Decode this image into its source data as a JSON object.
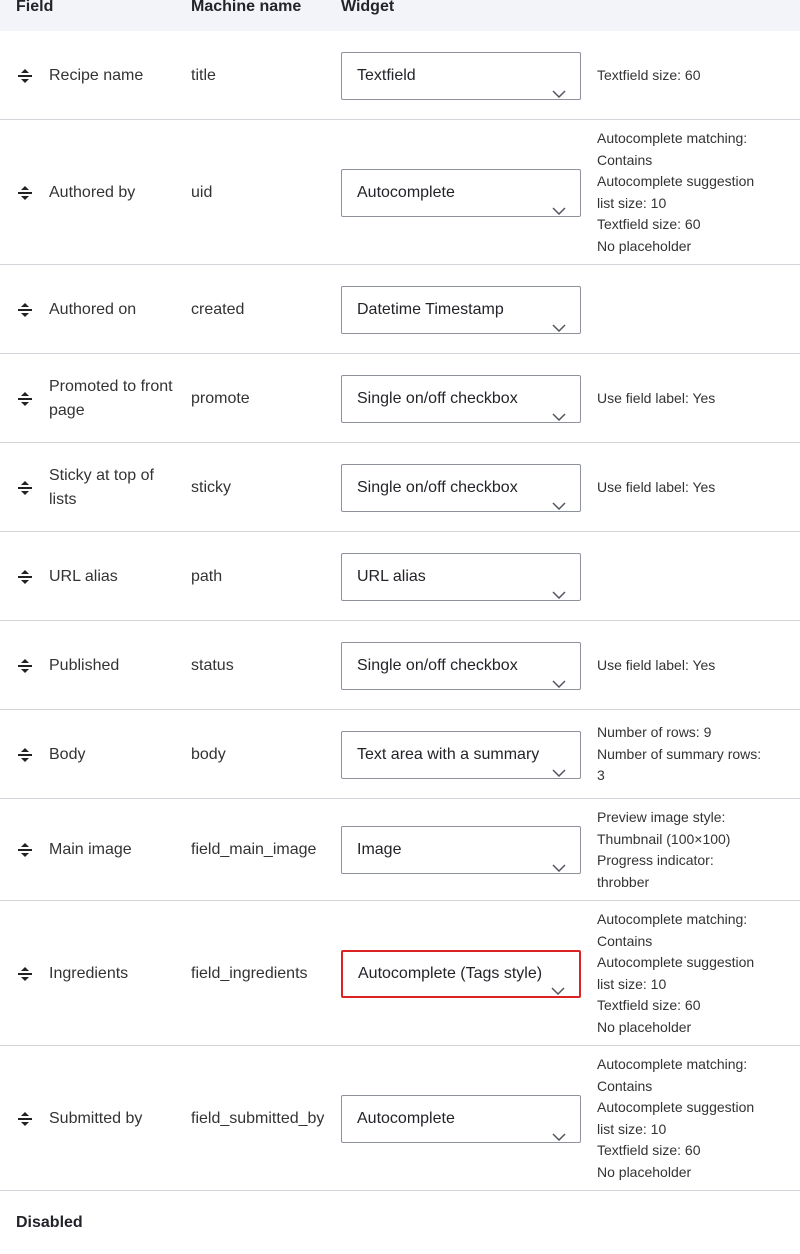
{
  "table": {
    "headers": {
      "field": "Field",
      "machine_name": "Machine name",
      "widget": "Widget"
    },
    "rows": [
      {
        "label": "Recipe name",
        "machine": "title",
        "widget": "Textfield",
        "summary": [
          "Textfield size: 60"
        ]
      },
      {
        "label": "Authored by",
        "machine": "uid",
        "widget": "Autocomplete",
        "summary": [
          "Autocomplete matching:",
          "Contains",
          "Autocomplete suggestion",
          "list size: 10",
          "Textfield size: 60",
          "No placeholder"
        ]
      },
      {
        "label": "Authored on",
        "machine": "created",
        "widget": "Datetime Timestamp",
        "summary": []
      },
      {
        "label": "Promoted to front page",
        "machine": "promote",
        "widget": "Single on/off checkbox",
        "summary": [
          "Use field label: Yes"
        ]
      },
      {
        "label": "Sticky at top of lists",
        "machine": "sticky",
        "widget": "Single on/off checkbox",
        "summary": [
          "Use field label: Yes"
        ]
      },
      {
        "label": "URL alias",
        "machine": "path",
        "widget": "URL alias",
        "summary": []
      },
      {
        "label": "Published",
        "machine": "status",
        "widget": "Single on/off checkbox",
        "summary": [
          "Use field label: Yes"
        ]
      },
      {
        "label": "Body",
        "machine": "body",
        "widget": "Text area with a summary",
        "summary": [
          "Number of rows: 9",
          "Number of summary rows:",
          "3"
        ]
      },
      {
        "label": "Main image",
        "machine": "field_main_image",
        "widget": "Image",
        "summary": [
          "Preview image style:",
          "Thumbnail (100×100)",
          "Progress indicator:",
          "throbber"
        ]
      },
      {
        "label": "Ingredients",
        "machine": "field_ingredients",
        "widget": "Autocomplete (Tags style)",
        "widget_state": "error",
        "summary": [
          "Autocomplete matching:",
          "Contains",
          "Autocomplete suggestion",
          "list size: 10",
          "Textfield size: 60",
          "No placeholder"
        ]
      },
      {
        "label": "Submitted by",
        "machine": "field_submitted_by",
        "widget": "Autocomplete",
        "summary": [
          "Autocomplete matching:",
          "Contains",
          "Autocomplete suggestion",
          "list size: 10",
          "Textfield size: 60",
          "No placeholder"
        ]
      }
    ]
  },
  "disabled_section": {
    "title": "Disabled"
  },
  "colors": {
    "error_border": "#dc2323",
    "header_bg": "#f3f4f9"
  }
}
